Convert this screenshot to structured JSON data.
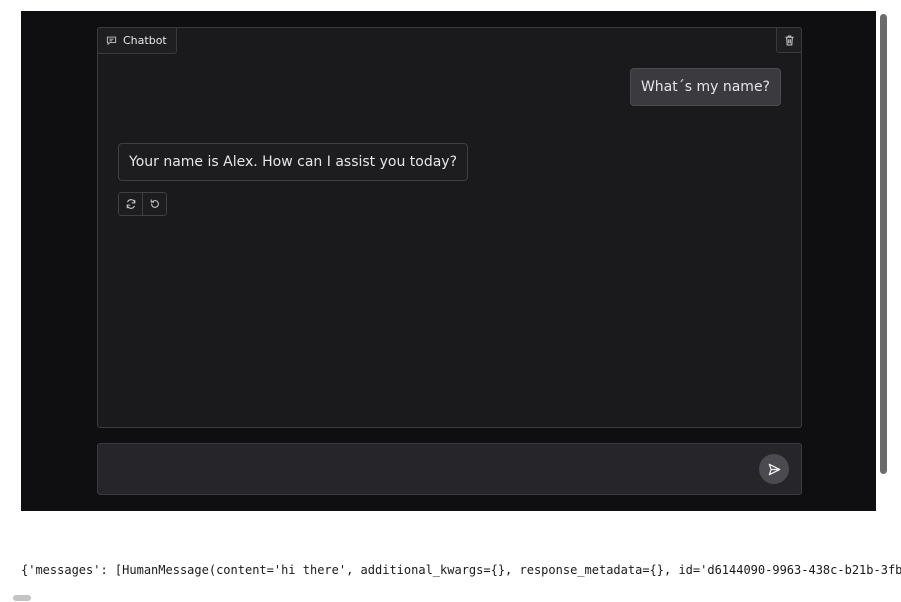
{
  "chat": {
    "label": "Chatbot",
    "messages": [
      {
        "role": "user",
        "text": "What´s my name?"
      },
      {
        "role": "assistant",
        "text": "Your name is Alex. How can I assist you today?"
      }
    ]
  },
  "input": {
    "value": "",
    "placeholder": ""
  },
  "output": {
    "text": "{'messages': [HumanMessage(content='hi there', additional_kwargs={}, response_metadata={}, id='d6144090-9963-438c-b21b-3fb"
  },
  "icons": {
    "chat_label": "chat-bubble-icon",
    "trash": "trash-icon",
    "retry": "retry-icon",
    "undo": "undo-icon",
    "send": "send-icon"
  },
  "colors": {
    "app_background": "#0f0f11",
    "panel_background": "#1a1a1c",
    "user_bubble": "#3a3a3f",
    "text": "#e6e6e8"
  }
}
